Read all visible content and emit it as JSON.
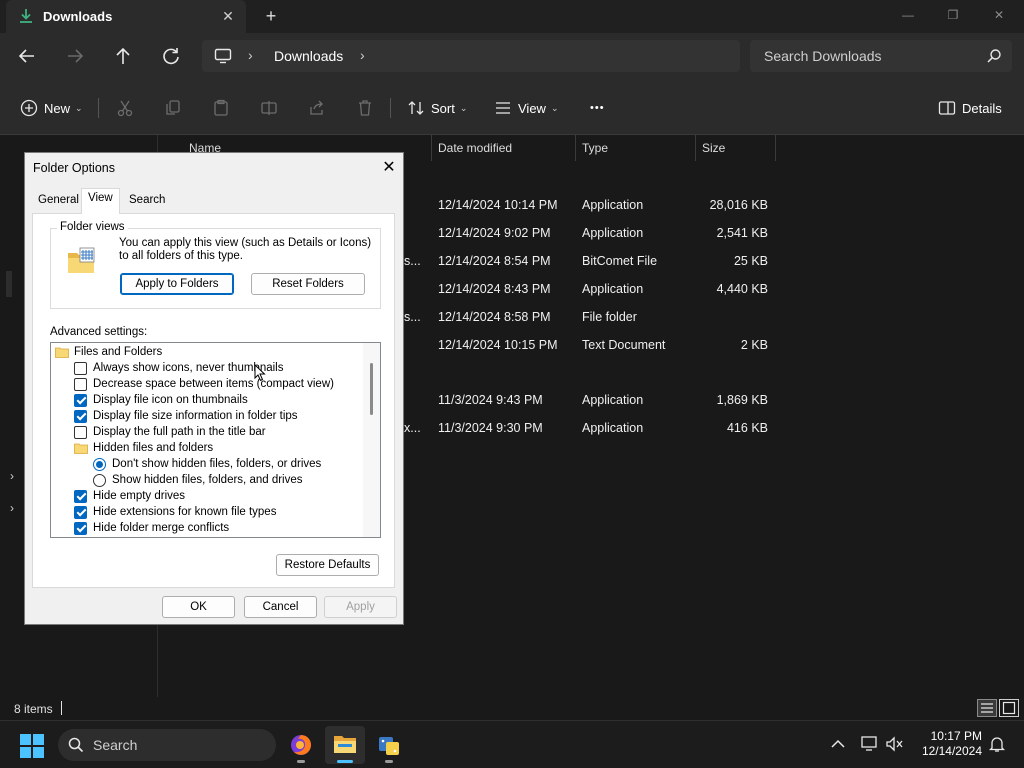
{
  "window": {
    "tab_title": "Downloads",
    "tab_close": "✕",
    "new_tab": "+",
    "minimize": "—",
    "maximize": "❐",
    "close": "✕"
  },
  "address": {
    "crumb_sep": "›",
    "crumb": "Downloads",
    "search_placeholder": "Search Downloads"
  },
  "commandbar": {
    "new": "New",
    "sort": "Sort",
    "view": "View",
    "more": "•••",
    "details": "Details"
  },
  "columns": {
    "name": "Name",
    "date": "Date modified",
    "type": "Type",
    "size": "Size"
  },
  "files": [
    {
      "name_tail": "",
      "date": "12/14/2024 10:14 PM",
      "type": "Application",
      "size": "28,016 KB"
    },
    {
      "name_tail": "",
      "date": "12/14/2024 9:02 PM",
      "type": "Application",
      "size": "2,541 KB"
    },
    {
      "name_tail": "s...",
      "date": "12/14/2024 8:54 PM",
      "type": "BitComet File",
      "size": "25 KB"
    },
    {
      "name_tail": "",
      "date": "12/14/2024 8:43 PM",
      "type": "Application",
      "size": "4,440 KB"
    },
    {
      "name_tail": "s...",
      "date": "12/14/2024 8:58 PM",
      "type": "File folder",
      "size": ""
    },
    {
      "name_tail": "",
      "date": "12/14/2024 10:15 PM",
      "type": "Text Document",
      "size": "2 KB"
    },
    {
      "name_tail": "",
      "date": "11/3/2024 9:43 PM",
      "type": "Application",
      "size": "1,869 KB"
    },
    {
      "name_tail": "x...",
      "date": "11/3/2024 9:30 PM",
      "type": "Application",
      "size": "416 KB"
    }
  ],
  "status": {
    "count": "8 items"
  },
  "dialog": {
    "title": "Folder Options",
    "close": "✕",
    "tabs": [
      "General",
      "View",
      "Search"
    ],
    "active_tab": "View",
    "folder_views": {
      "label": "Folder views",
      "description": "You can apply this view (such as Details or Icons) to all folders of this type.",
      "apply_button": "Apply to Folders",
      "reset_button": "Reset Folders"
    },
    "advanced_label": "Advanced settings:",
    "tree": [
      {
        "kind": "folder",
        "label": "Files and Folders",
        "checked": false
      },
      {
        "kind": "checkbox",
        "label": "Always show icons, never thumbnails",
        "checked": false
      },
      {
        "kind": "checkbox",
        "label": "Decrease space between items (compact view)",
        "checked": false
      },
      {
        "kind": "checkbox",
        "label": "Display file icon on thumbnails",
        "checked": true
      },
      {
        "kind": "checkbox",
        "label": "Display file size information in folder tips",
        "checked": true
      },
      {
        "kind": "checkbox",
        "label": "Display the full path in the title bar",
        "checked": false
      },
      {
        "kind": "folder",
        "label": "Hidden files and folders",
        "checked": false
      },
      {
        "kind": "radio",
        "label": "Don't show hidden files, folders, or drives",
        "checked": true
      },
      {
        "kind": "radio",
        "label": "Show hidden files, folders, and drives",
        "checked": false
      },
      {
        "kind": "checkbox",
        "label": "Hide empty drives",
        "checked": true
      },
      {
        "kind": "checkbox",
        "label": "Hide extensions for known file types",
        "checked": true
      },
      {
        "kind": "checkbox",
        "label": "Hide folder merge conflicts",
        "checked": true
      }
    ],
    "restore_defaults": "Restore Defaults",
    "ok": "OK",
    "cancel": "Cancel",
    "apply": "Apply"
  },
  "taskbar": {
    "search_placeholder": "Search",
    "time": "10:17 PM",
    "date": "12/14/2024",
    "apps": [
      "firefox",
      "file-explorer",
      "python-installer"
    ]
  },
  "colors": {
    "accent": "#0067c0",
    "taskbar_active": "#4cc2ff",
    "download_icon": "#3fb37f",
    "folder_yellow": "#f8d775"
  }
}
